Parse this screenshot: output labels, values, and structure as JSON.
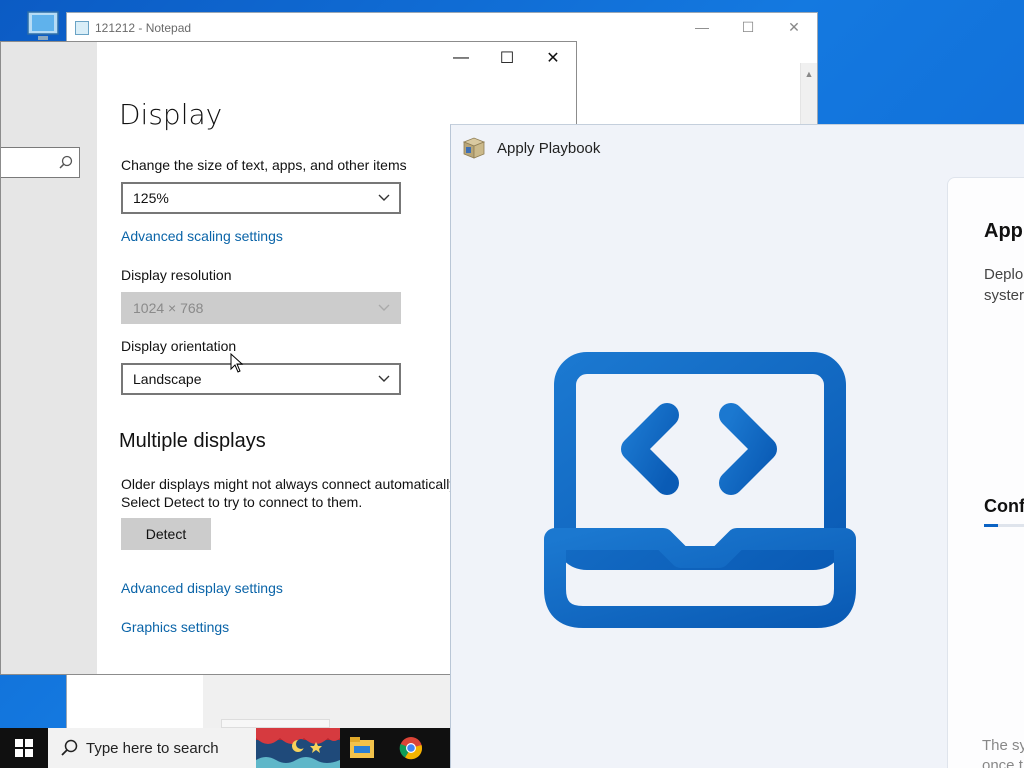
{
  "notepad": {
    "title": "121212 - Notepad",
    "controls": {
      "minimize": "—",
      "maximize": "☐",
      "close": "✕"
    }
  },
  "settings": {
    "controls": {
      "minimize": "—",
      "maximize": "☐",
      "close": "✕"
    },
    "page_title": "Display",
    "scale_label": "Change the size of text, apps, and other items",
    "scale_value": "125%",
    "advanced_scaling_link": "Advanced scaling settings",
    "resolution_label": "Display resolution",
    "resolution_value": "1024 × 768",
    "orientation_label": "Display orientation",
    "orientation_value": "Landscape",
    "multiple_displays_heading": "Multiple displays",
    "multiple_displays_text": "Older displays might not always connect automatically. Select Detect to try to connect to them.",
    "detect_button": "Detect",
    "advanced_display_link": "Advanced display settings",
    "graphics_link": "Graphics settings"
  },
  "playbook": {
    "window_title": "Apply Playbook",
    "card_title": "Appl",
    "card_desc_line1": "Deplo",
    "card_desc_line2": "syster",
    "section_title": "Conf",
    "progress_fraction": 0.18,
    "footer_line1": "The sy",
    "footer_line2": "once t"
  },
  "taskbar": {
    "search_placeholder": "Type here to search"
  },
  "colors": {
    "desktop": "#1479e0",
    "link": "#0a64a8",
    "playbook_accent": "#0b63c4",
    "taskbar": "#101010"
  },
  "icons": [
    "windows-start-icon",
    "search-icon",
    "file-explorer-icon",
    "chrome-icon",
    "laptop-code-icon",
    "package-icon",
    "recycle-bin-icon",
    "notepad-icon",
    "chevron-down-icon"
  ]
}
